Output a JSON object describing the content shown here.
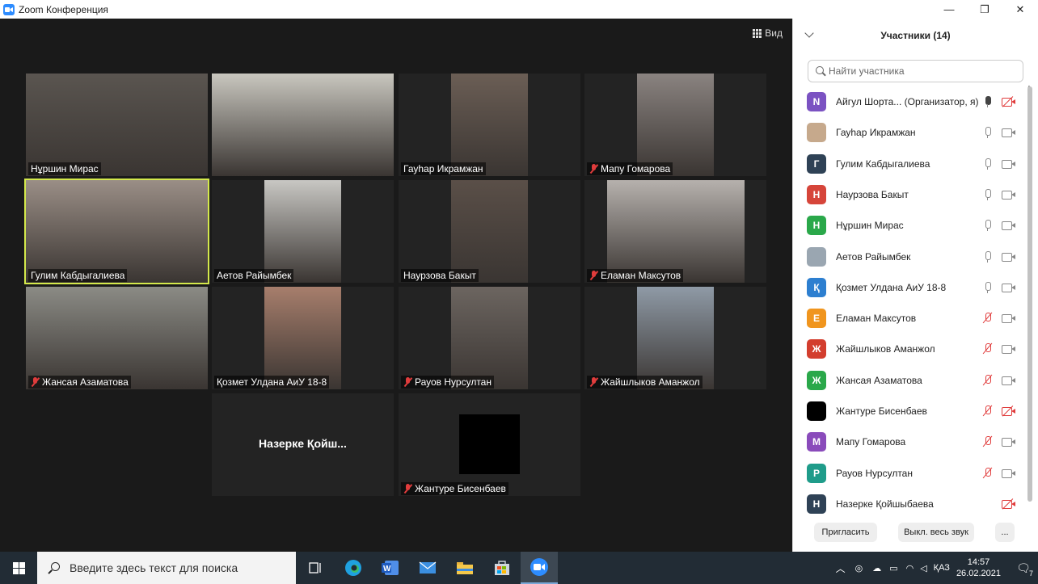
{
  "window": {
    "title": "Zoom Конференция",
    "controls": [
      "—",
      "❐",
      "✕"
    ]
  },
  "toolbar": {
    "view_label": "Вид"
  },
  "tiles": [
    {
      "name": "Нұршин Мирас",
      "muted": false,
      "bg": "#5a5550"
    },
    {
      "name": "",
      "muted": false,
      "bg": "#c9c7bf"
    },
    {
      "name": "Гауһар Икрамжан",
      "muted": false,
      "bg": "#6b5e55"
    },
    {
      "name": "Мапу Гомарова",
      "muted": true,
      "bg": "#8a8380"
    },
    {
      "name": "Гулим Кабдыгалиева",
      "muted": false,
      "bg": "#9a8e86"
    },
    {
      "name": "Аетов Райымбек",
      "muted": false,
      "bg": "#c8c7c3"
    },
    {
      "name": "Наурзова Бакыт",
      "muted": false,
      "bg": "#5a4f48"
    },
    {
      "name": "Еламан Максутов",
      "muted": true,
      "bg": "#b6b1ad"
    },
    {
      "name": "Жансая Азаматова",
      "muted": true,
      "bg": "#8b8b85"
    },
    {
      "name": "Қозмет Улдана АиУ 18-8",
      "muted": false,
      "bg": "#a77e6c"
    },
    {
      "name": "Рауов Нурсултан",
      "muted": true,
      "bg": "#6c6560"
    },
    {
      "name": "Жайшлыков Аманжол",
      "muted": true,
      "bg": "#8f9aa6"
    }
  ],
  "placeholder_tile": {
    "name": "Назерке Қойш..."
  },
  "black_tile": {
    "name": "Жантуре Бисенбаев",
    "muted": true
  },
  "panel": {
    "title": "Участники (14)",
    "search_placeholder": "Найти участника",
    "participants": [
      {
        "initial": "N",
        "color": "#7b52c2",
        "name": "Айгул Шорта...  (Организатор, я)",
        "mic": "on",
        "cam": "off"
      },
      {
        "initial": "",
        "color": "#c6a98c",
        "name": "Гауһар Икрамжан",
        "mic": "idle",
        "cam": "on"
      },
      {
        "initial": "Г",
        "color": "#2f4256",
        "name": "Гулим Кабдыгалиева",
        "mic": "idle",
        "cam": "on"
      },
      {
        "initial": "Н",
        "color": "#d6453a",
        "name": "Наурзова Бакыт",
        "mic": "idle",
        "cam": "on"
      },
      {
        "initial": "Н",
        "color": "#2aa84a",
        "name": "Нұршин Мирас",
        "mic": "idle",
        "cam": "on"
      },
      {
        "initial": "",
        "color": "#9aa6b1",
        "name": "Аетов Райымбек",
        "mic": "idle",
        "cam": "on"
      },
      {
        "initial": "Қ",
        "color": "#2d7fd0",
        "name": "Қозмет Улдана АиУ 18-8",
        "mic": "idle",
        "cam": "on"
      },
      {
        "initial": "Е",
        "color": "#f0951e",
        "name": "Еламан Максутов",
        "mic": "muted",
        "cam": "on"
      },
      {
        "initial": "Ж",
        "color": "#d33e2e",
        "name": "Жайшлыков Аманжол",
        "mic": "muted",
        "cam": "on"
      },
      {
        "initial": "Ж",
        "color": "#2aa84a",
        "name": "Жансая Азаматова",
        "mic": "muted",
        "cam": "on"
      },
      {
        "initial": "",
        "color": "#000000",
        "name": "Жантуре Бисенбаев",
        "mic": "muted",
        "cam": "off"
      },
      {
        "initial": "М",
        "color": "#8a4bbb",
        "name": "Мапу Гомарова",
        "mic": "muted",
        "cam": "on"
      },
      {
        "initial": "Р",
        "color": "#1f9c8a",
        "name": "Рауов Нурсултан",
        "mic": "muted",
        "cam": "on"
      },
      {
        "initial": "Н",
        "color": "#2f4256",
        "name": "Назерке Қойшыбаева",
        "mic": "none",
        "cam": "off"
      }
    ],
    "invite_label": "Пригласить",
    "mute_all_label": "Выкл. весь звук",
    "more_label": "..."
  },
  "taskbar": {
    "search_placeholder": "Введите здесь текст для поиска",
    "language": "ҚАЗ",
    "time": "14:57",
    "date": "26.02.2021",
    "notification_count": "7",
    "colors": {
      "bg": "#222c35",
      "zoom": "#2d8cff"
    }
  }
}
